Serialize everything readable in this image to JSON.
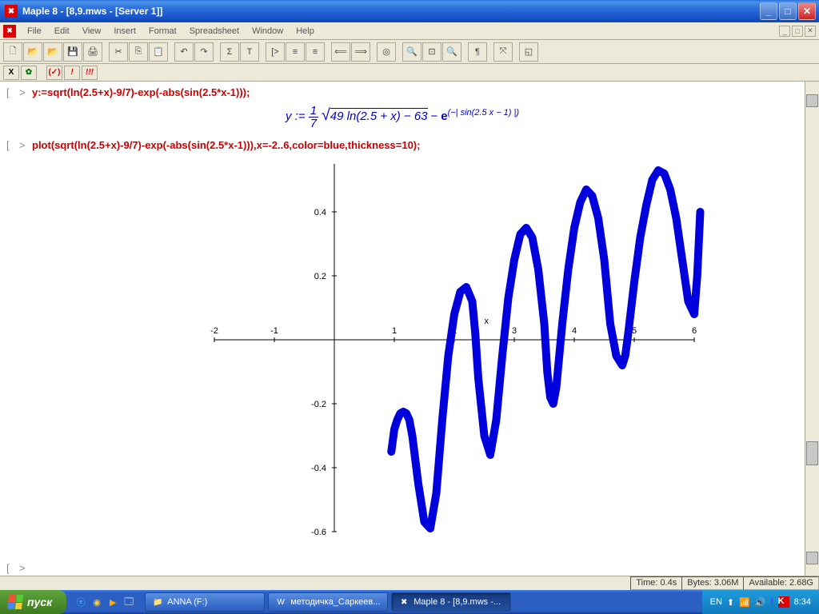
{
  "titlebar": {
    "app_icon": "✖",
    "text": "Maple 8  - [8,9.mws - [Server 1]]",
    "min": "_",
    "max": "□",
    "close": "✕"
  },
  "menu": {
    "items": [
      "File",
      "Edit",
      "View",
      "Insert",
      "Format",
      "Spreadsheet",
      "Window",
      "Help"
    ],
    "inner_min": "_",
    "inner_max": "□",
    "inner_close": "✕"
  },
  "toolbar": {
    "new": "🗋",
    "open": "📂",
    "open2": "📂",
    "save": "💾",
    "print": "🖨",
    "cut": "✂",
    "copy": "⎘",
    "paste": "📋",
    "undo": "↶",
    "redo": "↷",
    "sigma": "Σ",
    "text": "T",
    "group": "[>",
    "indent": "≡",
    "outdent": "≡",
    "back": "⟸",
    "fwd": "⟹",
    "stop": "◎",
    "zoom_in": "🔍",
    "zoom_100": "⊡",
    "zoom_out": "🔍",
    "para": "¶",
    "whitespace": "⤧",
    "resize": "◱"
  },
  "context": {
    "x": "X",
    "leaf": "✿",
    "sep": "",
    "check": "(✓)",
    "exc": "!",
    "exc3": "!!!"
  },
  "worksheet": {
    "prompt": ">",
    "bracket": "[",
    "cmd1": "y:=sqrt(ln(2.5+x)-9/7)-exp(-abs(sin(2.5*x-1)));",
    "math_lhs": "y := ",
    "math_frac_num": "1",
    "math_frac_den": "7",
    "math_sqrt_sym": "√",
    "math_sqrt_body": "49 ln(2.5 + x) − 63",
    "math_minus": " − ",
    "math_e": "e",
    "math_exp": "(−| sin(2.5 x − 1) |)",
    "cmd2": "plot(sqrt(ln(2.5+x)-9/7)-exp(-abs(sin(2.5*x-1))),x=-2..6,color=blue,thickness=10);"
  },
  "chart_data": {
    "type": "line",
    "xlabel": "x",
    "ylabel": "",
    "xlim": [
      -2,
      6
    ],
    "ylim": [
      -0.6,
      0.55
    ],
    "x_ticks": [
      -2,
      -1,
      0,
      1,
      2,
      3,
      4,
      5,
      6
    ],
    "y_ticks": [
      -0.6,
      -0.4,
      -0.2,
      0.2,
      0.4
    ],
    "color": "#0000dd",
    "thickness": 10,
    "x": [
      0.95,
      1.0,
      1.05,
      1.1,
      1.15,
      1.2,
      1.25,
      1.3,
      1.4,
      1.5,
      1.6,
      1.7,
      1.8,
      1.9,
      2.0,
      2.1,
      2.2,
      2.3,
      2.35,
      2.4,
      2.5,
      2.6,
      2.7,
      2.8,
      2.9,
      3.0,
      3.1,
      3.2,
      3.3,
      3.4,
      3.5,
      3.55,
      3.6,
      3.65,
      3.7,
      3.8,
      3.9,
      4.0,
      4.1,
      4.2,
      4.3,
      4.4,
      4.5,
      4.6,
      4.7,
      4.8,
      4.85,
      4.9,
      5.0,
      5.1,
      5.2,
      5.3,
      5.4,
      5.5,
      5.6,
      5.7,
      5.8,
      5.9,
      6.0,
      6.05,
      6.1
    ],
    "y": [
      -0.35,
      -0.28,
      -0.25,
      -0.23,
      -0.225,
      -0.23,
      -0.25,
      -0.3,
      -0.45,
      -0.57,
      -0.59,
      -0.48,
      -0.25,
      -0.05,
      0.08,
      0.15,
      0.165,
      0.12,
      0.02,
      -0.12,
      -0.3,
      -0.36,
      -0.25,
      -0.05,
      0.13,
      0.25,
      0.33,
      0.35,
      0.32,
      0.22,
      0.05,
      -0.1,
      -0.18,
      -0.2,
      -0.15,
      0.05,
      0.22,
      0.35,
      0.43,
      0.47,
      0.45,
      0.38,
      0.25,
      0.05,
      -0.05,
      -0.08,
      -0.05,
      0.02,
      0.18,
      0.32,
      0.42,
      0.5,
      0.53,
      0.52,
      0.47,
      0.38,
      0.25,
      0.12,
      0.08,
      0.2,
      0.4
    ]
  },
  "status": {
    "time": "Time: 0.4s",
    "bytes": "Bytes: 3.06M",
    "avail": "Available: 2.68G"
  },
  "taskbar": {
    "start": "пуск",
    "items": [
      {
        "icon": "📁",
        "label": "ANNA (F:)"
      },
      {
        "icon": "W",
        "label": "методичка_Саркеев..."
      },
      {
        "icon": "✖",
        "label": "Maple 8  - [8,9.mws -...",
        "active": true
      }
    ],
    "lang": "EN",
    "clock": "8:34"
  }
}
